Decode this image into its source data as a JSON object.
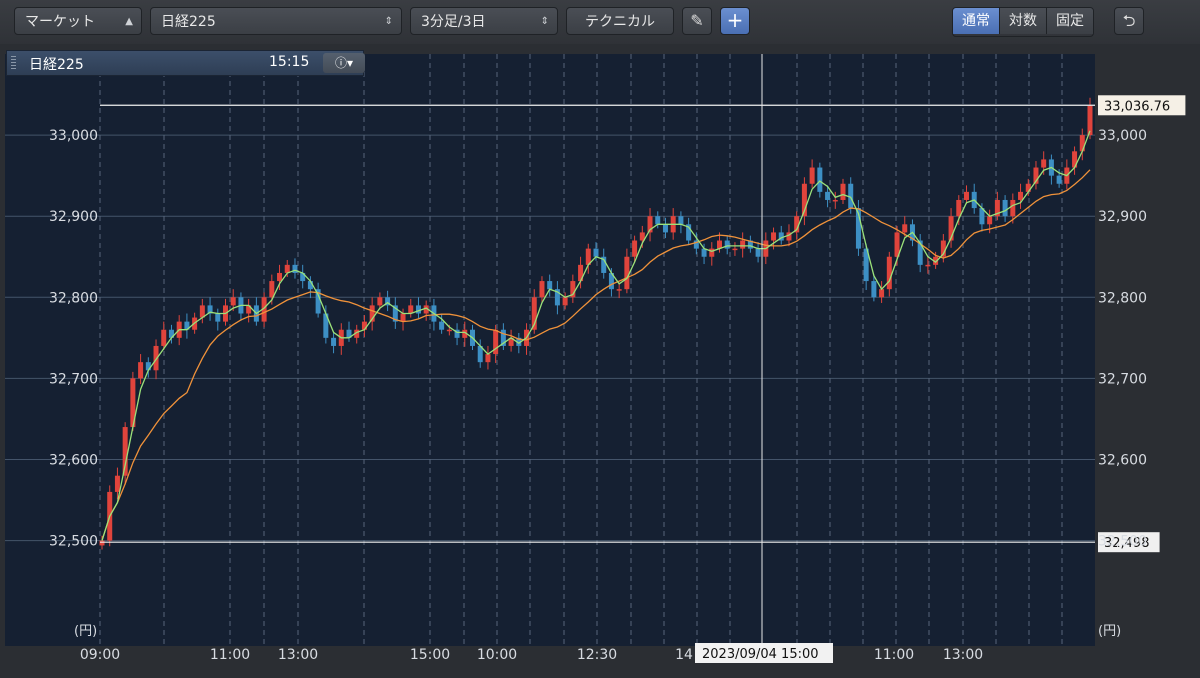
{
  "toolbar": {
    "market_label": "マーケット",
    "symbol_label": "日経225",
    "interval_label": "3分足/3日",
    "technical_label": "テクニカル",
    "scale_options": [
      "通常",
      "対数",
      "固定"
    ],
    "scale_selected": "通常"
  },
  "legend": {
    "symbol": "日経225",
    "time": "15:15",
    "info_icon": "info-icon"
  },
  "chart_data": {
    "type": "candlestick",
    "unit_label": "(円)",
    "y_ticks": [
      32500,
      32600,
      32700,
      32800,
      32900,
      33000
    ],
    "y_tick_labels": [
      "32,500",
      "32,600",
      "32,700",
      "32,800",
      "32,900",
      "33,000"
    ],
    "ylim": [
      32370,
      33100
    ],
    "x_tick_labels": [
      "09:00",
      "11:00",
      "13:00",
      "15:00",
      "10:00",
      "12:30",
      "14",
      "11:00",
      "13:00"
    ],
    "high_line": {
      "value": 33036.76,
      "label": "33,036.76"
    },
    "low_line": {
      "value": 32498,
      "label": "32,498"
    },
    "crosshair_label": "2023/09/04 15:00",
    "colors": {
      "up": "#e0443c",
      "down": "#3d8fc4",
      "ma_short": "#9be27a",
      "ma_long": "#f0923a",
      "background": "#152032",
      "grid": "#44546a"
    },
    "close_series": [
      32500,
      32560,
      32580,
      32640,
      32700,
      32720,
      32710,
      32740,
      32760,
      32750,
      32770,
      32760,
      32775,
      32790,
      32780,
      32770,
      32790,
      32800,
      32780,
      32790,
      32770,
      32800,
      32820,
      32830,
      32840,
      32830,
      32820,
      32810,
      32780,
      32750,
      32740,
      32760,
      32750,
      32760,
      32770,
      32790,
      32800,
      32790,
      32770,
      32780,
      32790,
      32780,
      32790,
      32770,
      32760,
      32760,
      32750,
      32760,
      32740,
      32720,
      32730,
      32760,
      32740,
      32750,
      32740,
      32760,
      32800,
      32820,
      32810,
      32790,
      32800,
      32820,
      32840,
      32860,
      32850,
      32830,
      32810,
      32810,
      32850,
      32870,
      32880,
      32900,
      32890,
      32880,
      32900,
      32890,
      32870,
      32860,
      32850,
      32860,
      32870,
      32860,
      32860,
      32870,
      32860,
      32850,
      32870,
      32880,
      32870,
      32880,
      32900,
      32940,
      32960,
      32930,
      32920,
      32920,
      32940,
      32910,
      32860,
      32820,
      32800,
      32810,
      32850,
      32880,
      32890,
      32870,
      32840,
      32840,
      32850,
      32870,
      32900,
      32920,
      32930,
      32910,
      32890,
      32900,
      32920,
      32900,
      32920,
      32930,
      32940,
      32960,
      32970,
      32950,
      32940,
      32960,
      32980,
      33000,
      33036
    ]
  }
}
